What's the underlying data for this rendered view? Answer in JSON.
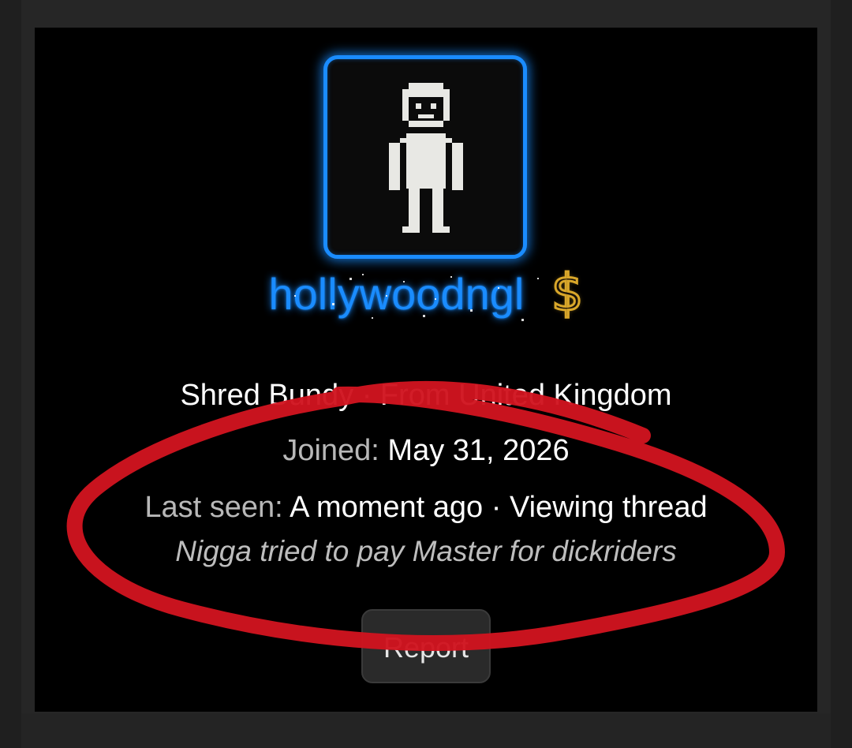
{
  "profile": {
    "username": "hollywoodngl",
    "badge_symbol": "$",
    "title_text": "Shred Bundy · From United Kingdom",
    "joined_label": "Joined:",
    "joined_value": "May 31, 2026",
    "last_seen_label": "Last seen:",
    "last_seen_value": "A moment ago · Viewing thread",
    "status_message": "Nigga tried to pay Master for dickriders"
  },
  "actions": {
    "report_label": "Report"
  },
  "colors": {
    "accent": "#1a8cff",
    "badge": "#d9a72a",
    "annotation": "#d0141f",
    "card_bg": "#000000"
  },
  "icons": {
    "avatar": "pixel-person-icon",
    "badge": "dollar-icon"
  }
}
